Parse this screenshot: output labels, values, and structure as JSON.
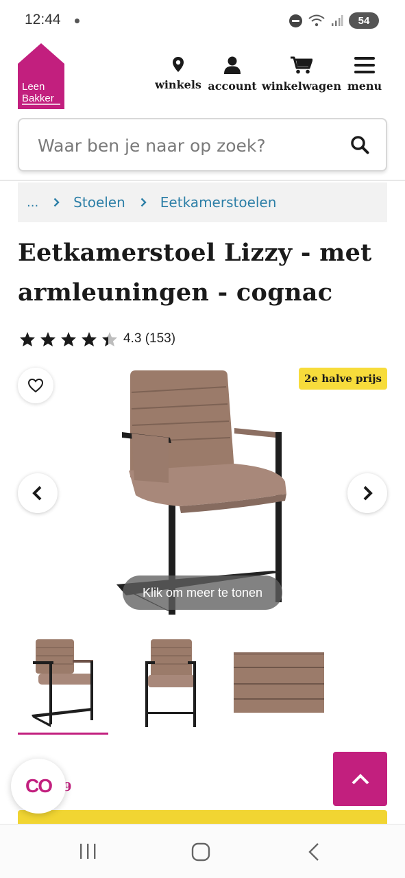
{
  "status_bar": {
    "time": "12:44",
    "battery": "54"
  },
  "header": {
    "logo_line1": "Leen",
    "logo_line2": "Bakker",
    "nav": [
      {
        "label": "winkels",
        "icon": "location-pin-icon"
      },
      {
        "label": "account",
        "icon": "person-icon"
      },
      {
        "label": "winkelwagen",
        "icon": "shopping-cart-icon"
      },
      {
        "label": "menu",
        "icon": "hamburger-menu-icon"
      }
    ],
    "brand_color": "#c21f7e"
  },
  "search": {
    "placeholder": "Waar ben je naar op zoek?"
  },
  "breadcrumb": {
    "ellipsis": "...",
    "items": [
      "Stoelen",
      "Eetkamerstoelen"
    ]
  },
  "product": {
    "title": "Eetkamerstoel Lizzy - met armleuningen - cognac",
    "rating": 4.3,
    "rating_text": "4.3 (153)",
    "promo_badge": "2e halve prijs",
    "more_label": "Klik om meer te tonen",
    "thumbnails": [
      "chair-front-angle",
      "chair-front",
      "fabric-detail"
    ],
    "selected_thumbnail": 0,
    "partial_price": "9"
  },
  "chat": {
    "logo": "CO"
  },
  "colors": {
    "accent": "#c21f7e",
    "promo": "#f7dc3b",
    "link": "#2d7fa7",
    "cognac": "#9b7b6a"
  }
}
